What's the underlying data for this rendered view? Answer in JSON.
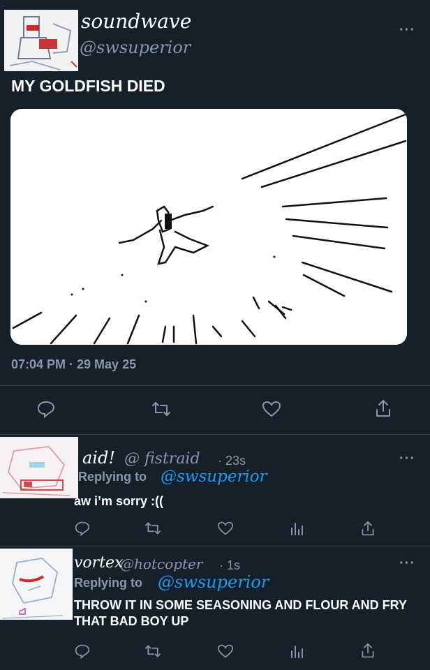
{
  "main_tweet": {
    "display_name": "soundwave",
    "handle": "@swsuperior",
    "text": "MY GOLDFISH DIED",
    "timestamp": "07:04 PM · 29 May 25",
    "more": "···"
  },
  "replies": [
    {
      "display_name": "aid!",
      "handle": "@ fistraid",
      "time": "· 23s",
      "replying_label": "Replying to",
      "replying_handle": "@swsuperior",
      "text": "aw i’m sorry :((",
      "more": "···"
    },
    {
      "display_name": "vortex",
      "handle": "@hotcopter",
      "time": "· 1s",
      "replying_label": "Replying to",
      "replying_handle": "@swsuperior",
      "text": "THROW IT IN SOME SEASONING AND FLOUR AND FRY THAT BAD BOY UP",
      "more": "···"
    }
  ],
  "colors": {
    "background": "#15202b",
    "divider": "#38444d",
    "muted": "#8899a6",
    "accent": "#1d9bf0",
    "text": "#ffffff"
  },
  "icons": {
    "reply": "reply-icon",
    "retweet": "retweet-icon",
    "like": "heart-icon",
    "analytics": "analytics-icon",
    "share": "share-icon"
  }
}
